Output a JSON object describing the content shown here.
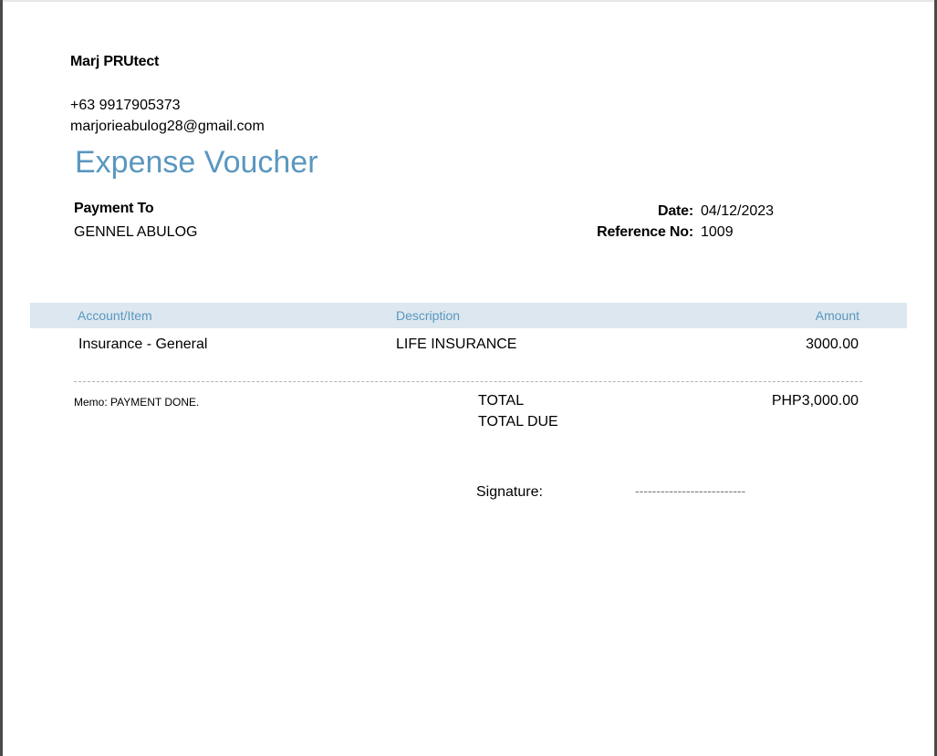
{
  "company": {
    "name": "Marj PRUtect",
    "phone": "+63 9917905373",
    "email": "marjorieabulog28@gmail.com"
  },
  "document": {
    "title": "Expense Voucher"
  },
  "payment_to": {
    "label": "Payment To",
    "name": "GENNEL ABULOG"
  },
  "meta": {
    "date_label": "Date:",
    "date_value": "04/12/2023",
    "reference_label": "Reference No:",
    "reference_value": "1009"
  },
  "table": {
    "headers": [
      "Account/Item",
      "Description",
      "Amount"
    ],
    "rows": [
      {
        "account": "Insurance - General",
        "description": "LIFE INSURANCE",
        "amount": "3000.00"
      }
    ]
  },
  "memo": {
    "text": "Memo: PAYMENT DONE."
  },
  "totals": {
    "total_label": "TOTAL",
    "total_due_label": "TOTAL DUE",
    "total_value": "PHP3,000.00"
  },
  "signature": {
    "label": "Signature:",
    "line": "--------------------------"
  },
  "colors": {
    "accent": "#5a97bf",
    "table_header_bg": "#dce7ef"
  }
}
